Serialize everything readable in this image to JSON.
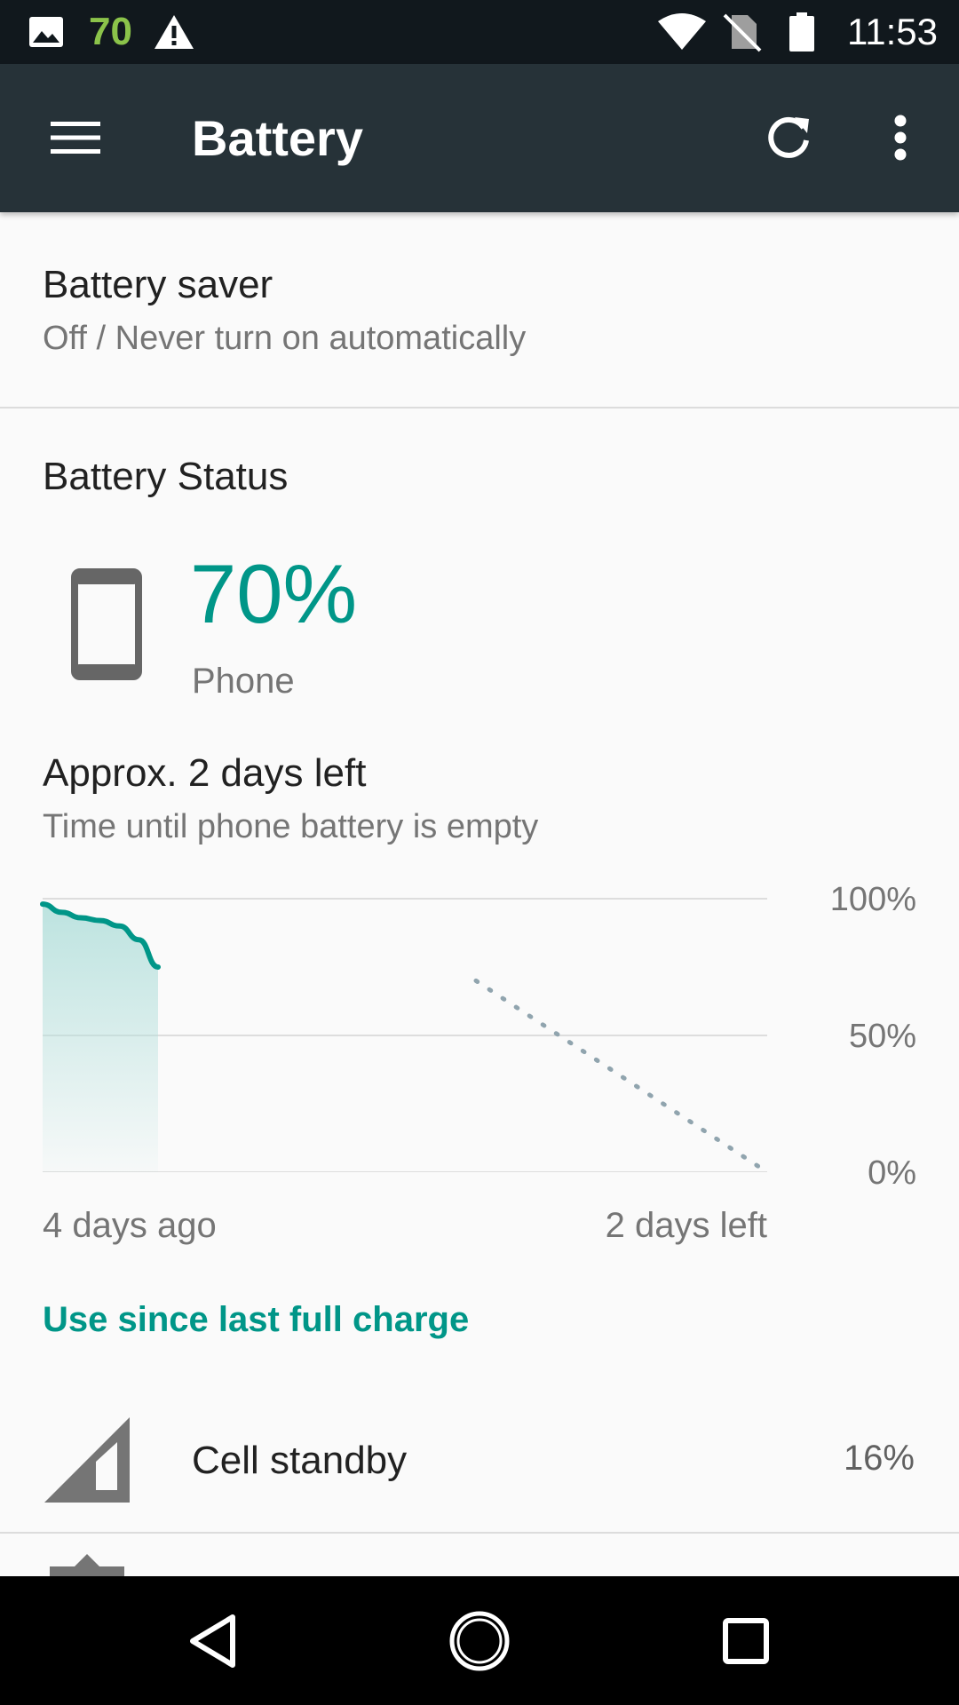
{
  "status_bar": {
    "left_icons": [
      "image-icon",
      "warning-icon"
    ],
    "notification_number": "70",
    "right_icons": [
      "wifi-icon",
      "no-sim-icon",
      "battery-icon"
    ],
    "clock": "11:53"
  },
  "toolbar": {
    "title": "Battery",
    "icons": [
      "menu-icon",
      "refresh-icon",
      "more-vert-icon"
    ]
  },
  "battery_saver": {
    "title": "Battery saver",
    "subtitle": "Off / Never turn on automatically"
  },
  "battery_status": {
    "heading": "Battery Status",
    "device_icon": "phone-icon",
    "percent": "70%",
    "device": "Phone",
    "estimate_title": "Approx. 2 days left",
    "estimate_subtitle": "Time until phone battery is empty"
  },
  "chart_data": {
    "type": "area",
    "y_tick_labels": [
      "100%",
      "50%",
      "0%"
    ],
    "ylim": [
      0,
      100
    ],
    "x_tick_labels": [
      "4 days ago",
      "2 days left"
    ],
    "series": [
      {
        "values": [
          98,
          95,
          93,
          92,
          90,
          85,
          75
        ]
      }
    ],
    "projection": {
      "start": 70,
      "end": 0
    },
    "accent_color": "#009688",
    "projection_color": "#90a4ae",
    "grid": true
  },
  "usage": {
    "header": "Use since last full charge",
    "items": [
      {
        "icon": "cell-signal-icon",
        "label": "Cell standby",
        "percent": "16%"
      }
    ]
  },
  "nav_bar": {
    "icons": [
      "back-icon",
      "home-icon",
      "recents-icon"
    ]
  }
}
